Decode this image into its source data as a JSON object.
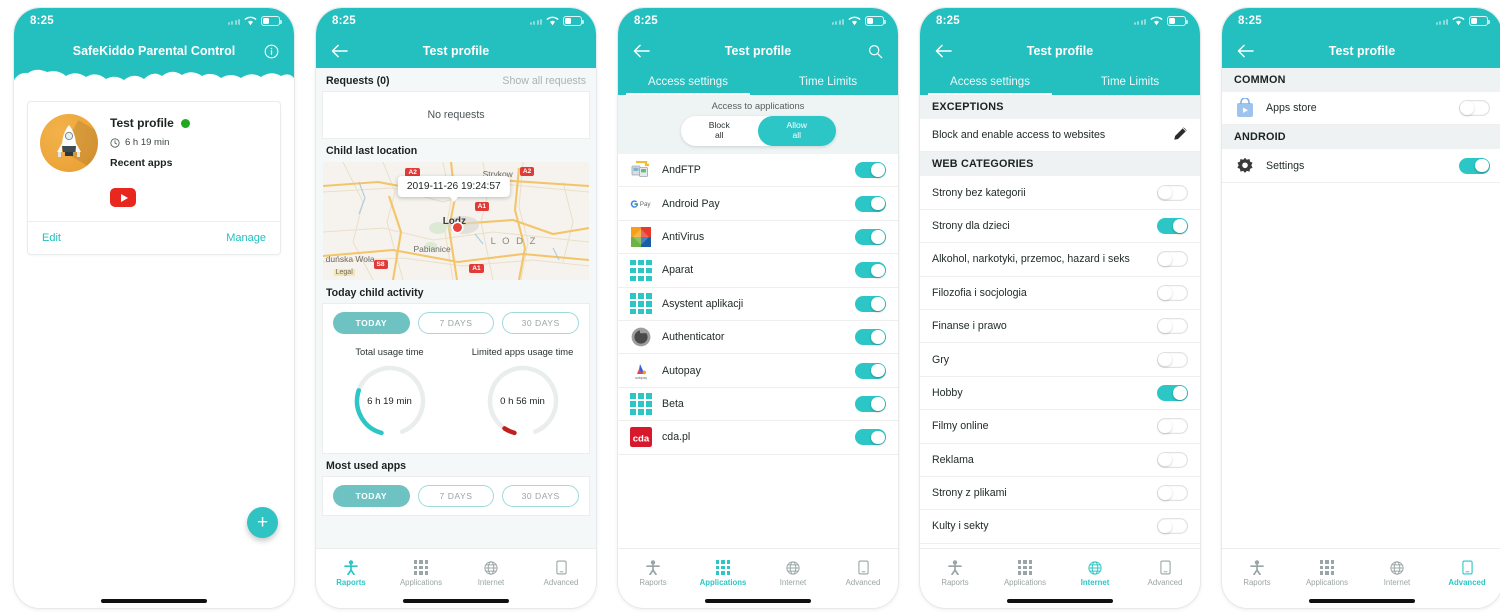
{
  "status_bar": {
    "time": "8:25"
  },
  "colors": {
    "accent": "#24bfbf",
    "toggle_on": "#2cc6c6",
    "online": "#20a820",
    "danger": "#e8413a"
  },
  "bottom_nav": [
    {
      "label": "Raports",
      "icon": "child-icon"
    },
    {
      "label": "Applications",
      "icon": "grid-icon"
    },
    {
      "label": "Internet",
      "icon": "globe-icon"
    },
    {
      "label": "Advanced",
      "icon": "phone-icon"
    }
  ],
  "screen1": {
    "title": "SafeKiddo Parental Control",
    "info_icon": "info-icon",
    "profile": {
      "name": "Test profile",
      "status": "online",
      "usage_time": "6 h  19 min",
      "recent_apps_label": "Recent apps",
      "recent_apps": [
        {
          "name": "YouTube",
          "icon": "youtube-icon"
        }
      ],
      "edit_label": "Edit",
      "manage_label": "Manage"
    },
    "fab_label": "+"
  },
  "screen2": {
    "title": "Test profile",
    "back_icon": "arrow-left-icon",
    "requests_label": "Requests (0)",
    "show_all_requests": "Show all requests",
    "no_requests": "No requests",
    "child_last_location": "Child last location",
    "map": {
      "timestamp_bubble": "2019-11-26 19:24:57",
      "labels": [
        "Strykow",
        "Lodz",
        "L O D Z",
        "Pabianice",
        "duńska Wola",
        "Legal"
      ],
      "road_badges": [
        "A2",
        "A2",
        "A1",
        "S8",
        "A1"
      ]
    },
    "today_child_activity": "Today child activity",
    "range_tabs": [
      {
        "label": "TODAY",
        "active": true
      },
      {
        "label": "7 DAYS",
        "active": false
      },
      {
        "label": "30 DAYS",
        "active": false
      }
    ],
    "gauges": [
      {
        "title": "Total usage time",
        "value": "6 h  19 min",
        "percent": 26,
        "color": "#2cc6c6"
      },
      {
        "title": "Limited apps usage time",
        "value": "0 h  56 min",
        "percent": 4,
        "color": "#c0201f"
      }
    ],
    "most_used_apps": "Most used apps",
    "most_used_tabs": [
      {
        "label": "TODAY",
        "active": true
      },
      {
        "label": "7 DAYS",
        "active": false
      },
      {
        "label": "30 DAYS",
        "active": false
      }
    ],
    "active_nav": 0
  },
  "screen3": {
    "title": "Test profile",
    "back_icon": "arrow-left-icon",
    "search_icon": "search-icon",
    "tabs": [
      {
        "label": "Access settings",
        "active": true
      },
      {
        "label": "Time Limits",
        "active": false
      }
    ],
    "access_title": "Access to applications",
    "access_options": [
      {
        "label_line1": "Block",
        "label_line2": "all",
        "selected": false
      },
      {
        "label_line1": "Allow",
        "label_line2": "all",
        "selected": true
      }
    ],
    "apps": [
      {
        "name": "AndFTP",
        "icon": "andftp-icon",
        "enabled": true
      },
      {
        "name": "Android Pay",
        "icon": "gpay-icon",
        "enabled": true
      },
      {
        "name": "AntiVirus",
        "icon": "avg-icon",
        "enabled": true
      },
      {
        "name": "Aparat",
        "icon": "generic-app-icon",
        "enabled": true
      },
      {
        "name": "Asystent aplikacji",
        "icon": "generic-app-icon",
        "enabled": true
      },
      {
        "name": "Authenticator",
        "icon": "authenticator-icon",
        "enabled": true
      },
      {
        "name": "Autopay",
        "icon": "autopay-icon",
        "enabled": true
      },
      {
        "name": "Beta",
        "icon": "generic-app-icon",
        "enabled": true
      },
      {
        "name": "cda.pl",
        "icon": "cda-icon",
        "enabled": true
      }
    ],
    "active_nav": 1
  },
  "screen4": {
    "title": "Test profile",
    "back_icon": "arrow-left-icon",
    "tabs": [
      {
        "label": "Access settings",
        "active": true
      },
      {
        "label": "Time Limits",
        "active": false
      }
    ],
    "exceptions_header": "EXCEPTIONS",
    "exceptions_row": {
      "label": "Block and enable access to websites",
      "icon": "pencil-icon"
    },
    "web_categories_header": "WEB CATEGORIES",
    "categories": [
      {
        "label": "Strony bez kategorii",
        "enabled": false
      },
      {
        "label": "Strony dla dzieci",
        "enabled": true
      },
      {
        "label": "Alkohol, narkotyki, przemoc, hazard i seks",
        "enabled": false
      },
      {
        "label": "Filozofia i socjologia",
        "enabled": false
      },
      {
        "label": "Finanse i prawo",
        "enabled": false
      },
      {
        "label": "Gry",
        "enabled": false
      },
      {
        "label": "Hobby",
        "enabled": true
      },
      {
        "label": "Filmy online",
        "enabled": false
      },
      {
        "label": "Reklama",
        "enabled": false
      },
      {
        "label": "Strony z plikami",
        "enabled": false
      },
      {
        "label": "Kulty i sekty",
        "enabled": false
      }
    ],
    "active_nav": 2
  },
  "screen5": {
    "title": "Test profile",
    "back_icon": "arrow-left-icon",
    "sections": [
      {
        "header": "COMMON",
        "items": [
          {
            "label": "Apps store",
            "icon": "store-icon",
            "enabled": false
          }
        ]
      },
      {
        "header": "ANDROID",
        "items": [
          {
            "label": "Settings",
            "icon": "gear-icon",
            "enabled": true
          }
        ]
      }
    ],
    "active_nav": 3
  }
}
